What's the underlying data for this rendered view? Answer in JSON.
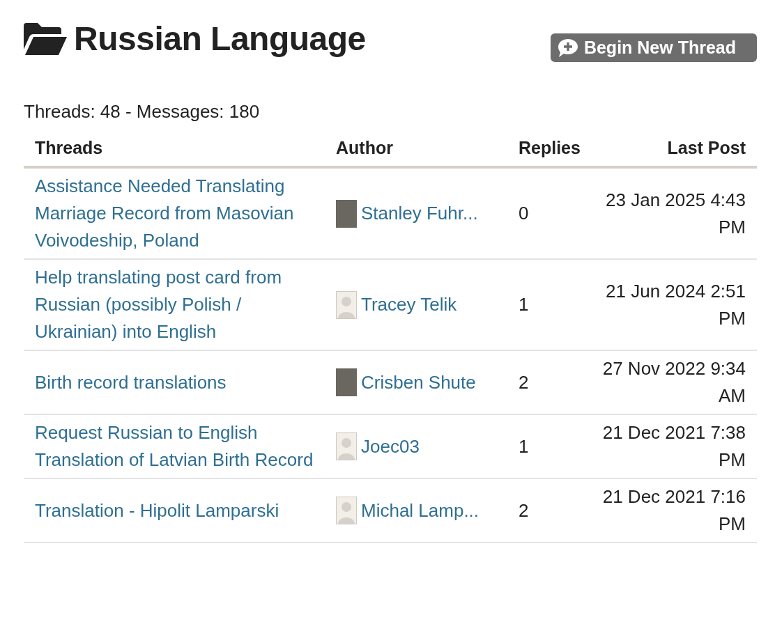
{
  "title": "Russian Language",
  "new_thread_button": "Begin New Thread",
  "stats": "Threads: 48 - Messages: 180",
  "table": {
    "columns": [
      "Threads",
      "Author",
      "Replies",
      "Last Post"
    ],
    "rows": [
      {
        "title": "Assistance Needed Translating Marriage Record from Masovian Voivodeship, Poland",
        "author": "Stanley Fuhr...",
        "avatar": {
          "kind": "photo"
        },
        "replies": "0",
        "last_post": "23 Jan 2025 4:43 PM"
      },
      {
        "title": "Help translating post card from Russian (possibly Polish / Ukrainian) into English",
        "author": "Tracey Telik",
        "avatar": {
          "kind": "default"
        },
        "replies": "1",
        "last_post": "21 Jun 2024 2:51 PM"
      },
      {
        "title": "Birth record translations",
        "author": "Crisben Shute",
        "avatar": {
          "kind": "photo"
        },
        "replies": "2",
        "last_post": "27 Nov 2022 9:34 AM"
      },
      {
        "title": "Request Russian to English Translation of Latvian Birth Record",
        "author": "Joec03",
        "avatar": {
          "kind": "default"
        },
        "replies": "1",
        "last_post": "21 Dec 2021 7:38 PM"
      },
      {
        "title": "Translation - Hipolit Lamparski",
        "author": "Michal Lamp...",
        "avatar": {
          "kind": "default"
        },
        "replies": "2",
        "last_post": "21 Dec 2021 7:16 PM"
      }
    ]
  }
}
